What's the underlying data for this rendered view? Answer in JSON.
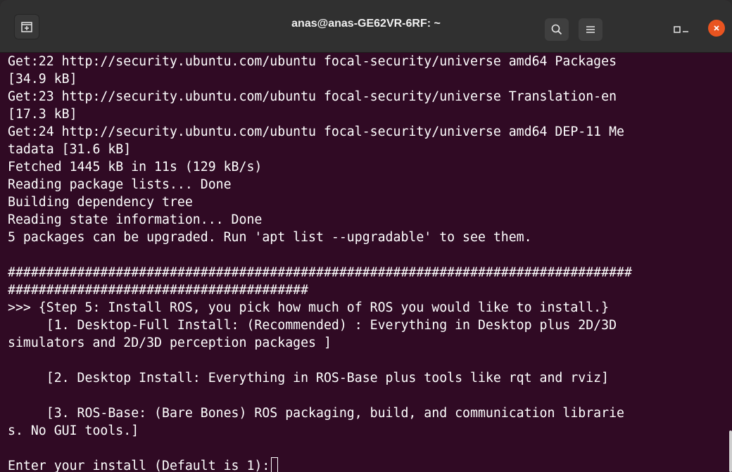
{
  "window": {
    "title": "anas@anas-GE62VR-6RF: ~"
  },
  "icons": {
    "new_tab": "new-tab-icon",
    "search": "search-icon",
    "menu": "hamburger-menu-icon",
    "minimize": "minimize-icon",
    "maximize": "maximize-icon",
    "close": "close-icon"
  },
  "colors": {
    "terminal_bg": "#300a24",
    "titlebar_bg": "#303030",
    "close_button": "#e95420",
    "text": "#ffffff"
  },
  "terminal": {
    "lines": [
      "Get:22 http://security.ubuntu.com/ubuntu focal-security/universe amd64 Packages",
      "[34.9 kB]",
      "Get:23 http://security.ubuntu.com/ubuntu focal-security/universe Translation-en",
      "[17.3 kB]",
      "Get:24 http://security.ubuntu.com/ubuntu focal-security/universe amd64 DEP-11 Me",
      "tadata [31.6 kB]",
      "Fetched 1445 kB in 11s (129 kB/s)",
      "Reading package lists... Done",
      "Building dependency tree",
      "Reading state information... Done",
      "5 packages can be upgraded. Run 'apt list --upgradable' to see them.",
      "",
      "#################################################################################",
      "#######################################",
      ">>> {Step 5: Install ROS, you pick how much of ROS you would like to install.}",
      "     [1. Desktop-Full Install: (Recommended) : Everything in Desktop plus 2D/3D",
      "simulators and 2D/3D perception packages ]",
      "",
      "     [2. Desktop Install: Everything in ROS-Base plus tools like rqt and rviz]",
      "",
      "     [3. ROS-Base: (Bare Bones) ROS packaging, build, and communication librarie",
      "s. No GUI tools.]",
      ""
    ],
    "prompt": "Enter your install (Default is 1):"
  }
}
